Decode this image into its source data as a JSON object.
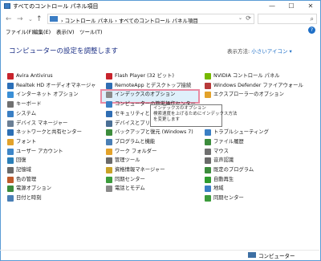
{
  "window": {
    "title": "すべてのコントロール パネル項目",
    "minimize_glyph": "—",
    "maximize_glyph": "☐",
    "close_glyph": "✕"
  },
  "nav": {
    "back": "←",
    "forward": "→",
    "dropdown": "⌄",
    "up": "↑"
  },
  "address": {
    "path": "›  コントロール パネル  ›  すべてのコントロール パネル項目",
    "dropdown": "⌄",
    "refresh": "⟳",
    "search_placeholder": "",
    "search_glyph": "⌕"
  },
  "menubar": {
    "items": [
      "ファイル(F)",
      "編集(E)",
      "表示(V)",
      "ツール(T)"
    ],
    "help": "?"
  },
  "header": {
    "title": "コンピューターの設定を調整します",
    "view_by_label": "表示方法:",
    "view_by_value": "小さいアイコン ▾"
  },
  "items": {
    "col1": [
      "Avira Antivirus",
      "Realtek HD オーディオマネージャ",
      "インターネット オプション",
      "キーボード",
      "システム",
      "デバイス マネージャー",
      "ネットワークと共有センター",
      "フォント",
      "ユーザー アカウント",
      "回復",
      "記憶域",
      "色の管理",
      "電源オプション",
      "日付と時刻"
    ],
    "col2": [
      "Flash Player (32 ビット)",
      "RemoteApp とデスクトップ接続",
      "インデックスのオプション",
      "コンピューターの簡単操作センター",
      "セキュリティとメンテナンス",
      "デバイスとプリンター",
      "バックアップと復元 (Windows 7)",
      "プログラムと機能",
      "ワーク フォルダー",
      "管理ツール",
      "資格情報マネージャー",
      "同期センター",
      "電話とモデム"
    ],
    "col3": [
      "NVIDIA コントロール パネル",
      "Windows Defender ファイアウォール",
      "エクスプローラーのオプション",
      "",
      "",
      "",
      "トラブルシューティング",
      "ファイル履歴",
      "マウス",
      "音声認識",
      "既定のプログラム",
      "自動再生",
      "地域",
      "同期センター"
    ],
    "colors1": [
      "#c8232c",
      "#2b6fb8",
      "#3a8fd6",
      "#707070",
      "#3a7fc4",
      "#6b7f95",
      "#2c6fb5",
      "#e3a22a",
      "#3e86c8",
      "#2b7fb8",
      "#6a6a6a",
      "#c05a2a",
      "#3c8c3c",
      "#4a7fb5"
    ],
    "colors2": [
      "#c8232c",
      "#2f6db3",
      "#8a8a8a",
      "#3b7fc4",
      "#2f6db3",
      "#4a6f95",
      "#3c8c3c",
      "#4a7fb5",
      "#e3a22a",
      "#6a6a6a",
      "#c9a227",
      "#3c9c3c",
      "#8a8a8a"
    ],
    "colors3": [
      "#76b900",
      "#b83a3a",
      "#e3a22a",
      "#ffffff",
      "#ffffff",
      "#ffffff",
      "#3a7fc4",
      "#3c8c3c",
      "#707070",
      "#6a6a6a",
      "#3c8c3c",
      "#2f9c2f",
      "#3a7fc4",
      "#3c9c3c"
    ]
  },
  "tooltip": {
    "line1": "インデックスのオプション",
    "line2": "検索速度を上げるためにインデックス方法",
    "line3": "を変更します"
  },
  "status": {
    "text": "コンピューター"
  }
}
